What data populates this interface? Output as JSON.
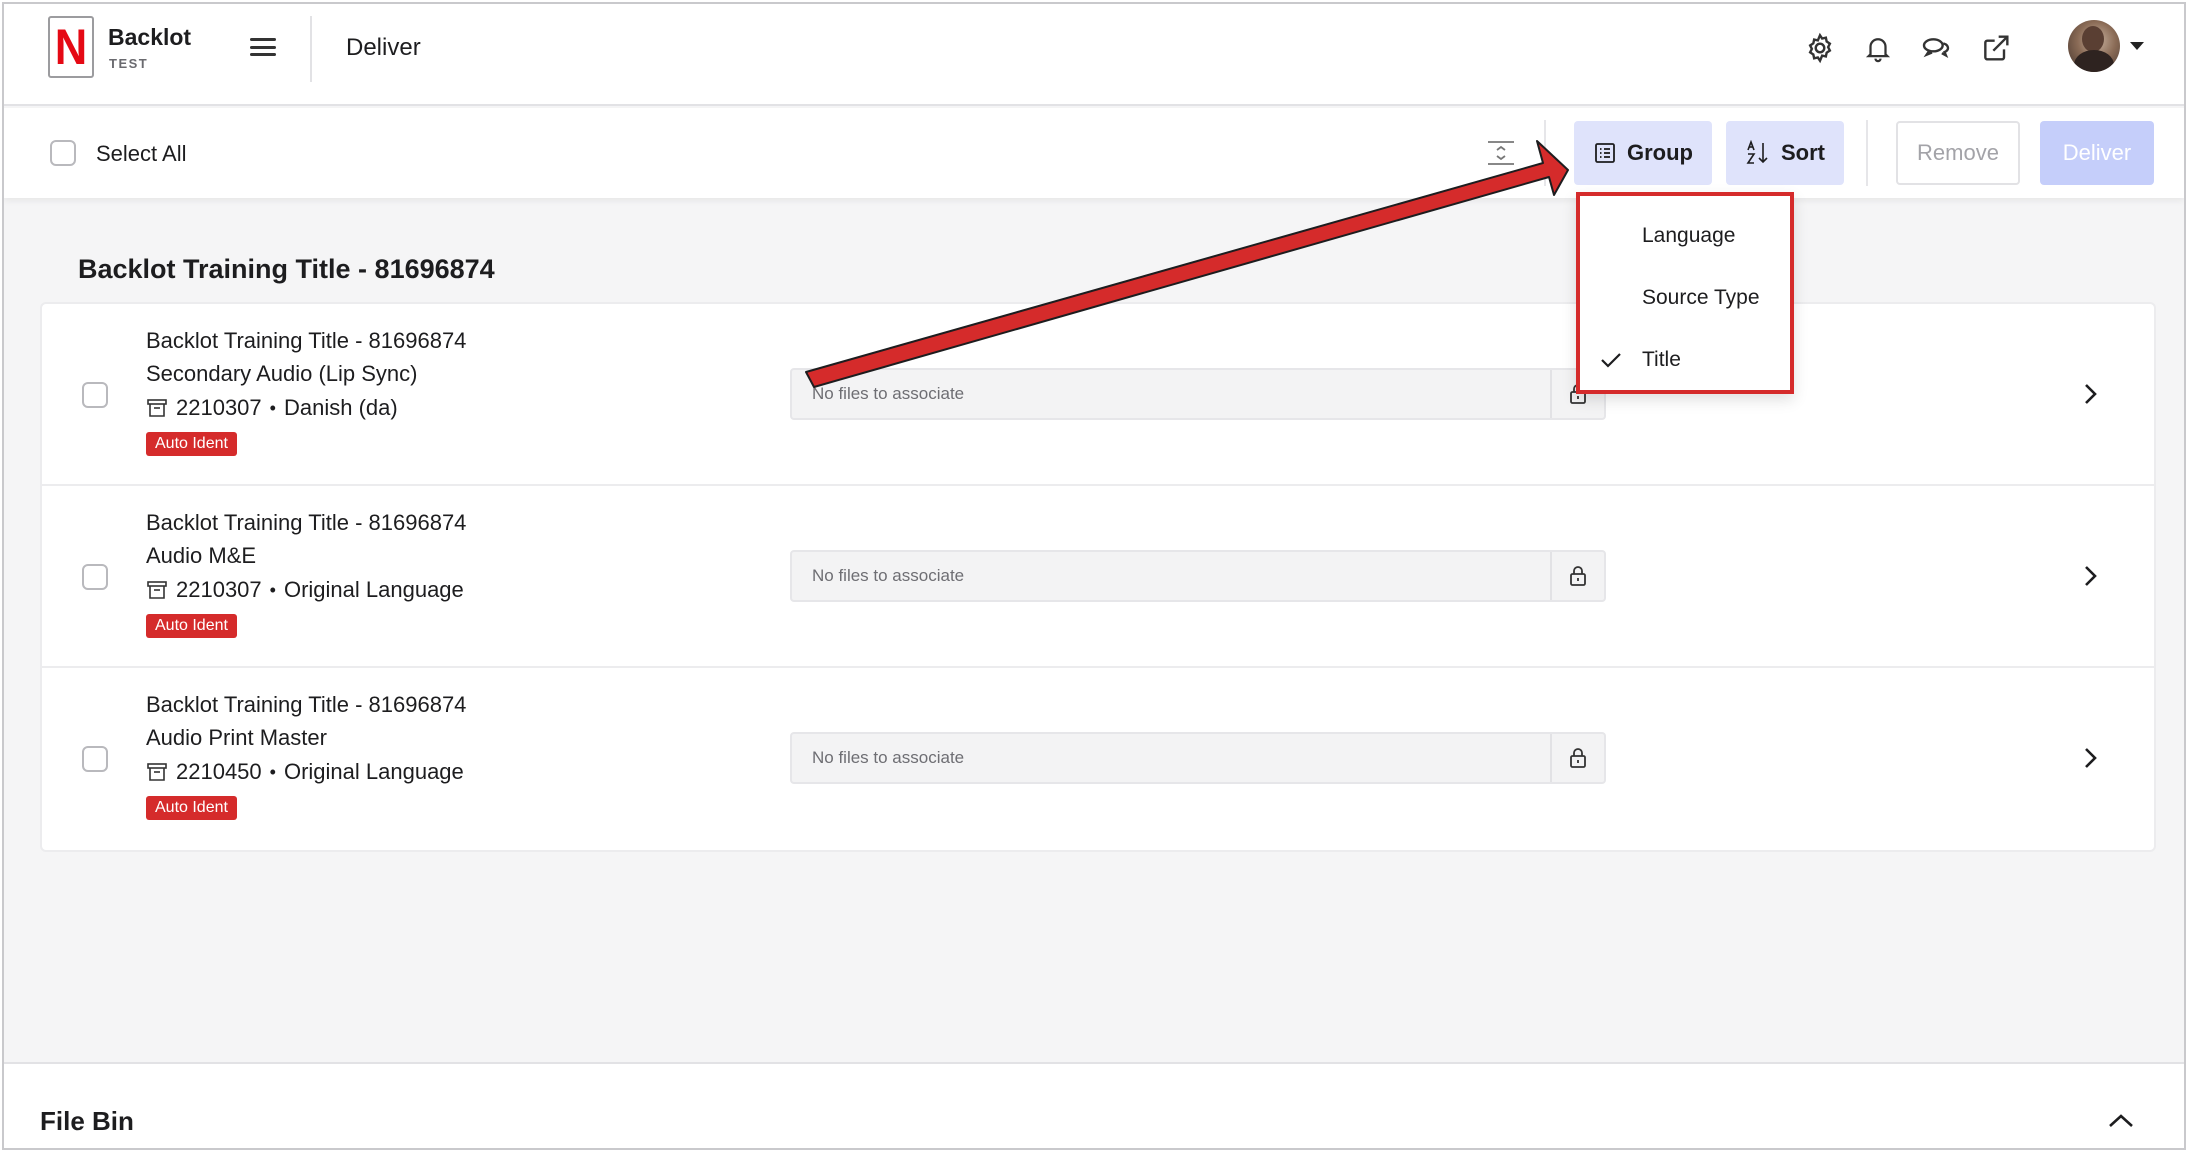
{
  "brand": {
    "logo_letter": "N",
    "name": "Backlot",
    "env": "TEST",
    "accent": "#e50914"
  },
  "header": {
    "page_title": "Deliver"
  },
  "toolbar": {
    "select_all_label": "Select All",
    "group_label": "Group",
    "sort_label": "Sort",
    "remove_label": "Remove",
    "deliver_label": "Deliver"
  },
  "group_menu": {
    "items": [
      {
        "label": "Language",
        "checked": false
      },
      {
        "label": "Source Type",
        "checked": false
      },
      {
        "label": "Title",
        "checked": true
      }
    ]
  },
  "group": {
    "heading": "Backlot Training Title - 81696874",
    "rows": [
      {
        "title": "Backlot Training Title - 81696874",
        "type": "Secondary Audio (Lip Sync)",
        "id": "2210307",
        "language": "Danish (da)",
        "badge": "Auto Ident",
        "file_placeholder": "No files to associate"
      },
      {
        "title": "Backlot Training Title - 81696874",
        "type": "Audio M&E",
        "id": "2210307",
        "language": "Original Language",
        "badge": "Auto Ident",
        "file_placeholder": "No files to associate"
      },
      {
        "title": "Backlot Training Title - 81696874",
        "type": "Audio Print Master",
        "id": "2210450",
        "language": "Original Language",
        "badge": "Auto Ident",
        "file_placeholder": "No files to associate"
      }
    ]
  },
  "file_bin": {
    "title": "File Bin"
  },
  "icons": {
    "header": [
      "settings-icon",
      "bell-icon",
      "chat-icon",
      "external-link-icon"
    ],
    "annotation_color": "#d52b2b"
  }
}
